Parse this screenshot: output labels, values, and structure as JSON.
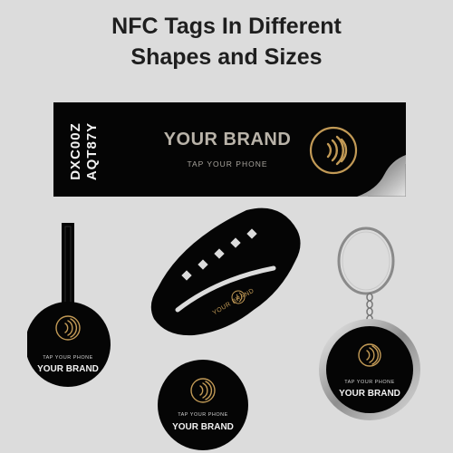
{
  "heading": {
    "line1": "NFC Tags In Different",
    "line2": "Shapes and Sizes"
  },
  "strip_tag": {
    "code_line1": "DXC00Z",
    "code_line2": "AQT87Y",
    "brand": "YOUR BRAND",
    "tap": "TAP YOUR PHONE"
  },
  "hang_tag": {
    "tap": "TAP YOUR PHONE",
    "brand": "YOUR BRAND"
  },
  "wristband": {
    "brand": "YOUR BRAND"
  },
  "round_tag": {
    "tap": "TAP YOUR PHONE",
    "brand": "YOUR BRAND"
  },
  "keychain": {
    "tap": "TAP YOUR PHONE",
    "brand": "YOUR BRAND"
  },
  "colors": {
    "background": "#dcdcdc",
    "tag_black": "#050505",
    "gold": "#c29a56",
    "silver": "#b9b9b9"
  },
  "icons": [
    "nfc-contactless-icon"
  ]
}
